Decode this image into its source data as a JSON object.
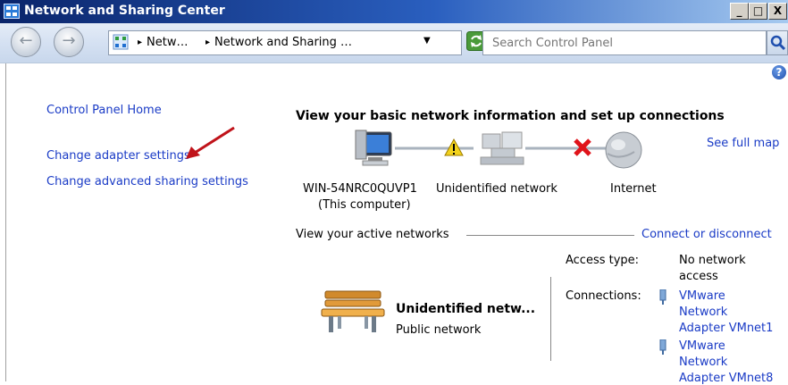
{
  "window": {
    "title": "Network and Sharing Center",
    "minimize": "_",
    "maximize": "□",
    "close": "X"
  },
  "navbar": {
    "back_label": "←",
    "forward_label": "→",
    "breadcrumb_sep": "▸",
    "breadcrumbs": [
      "Netw…",
      "Network and Sharing …"
    ],
    "dropdown_arrow": "▼",
    "search_placeholder": "Search Control Panel"
  },
  "sidebar": {
    "home": "Control Panel Home",
    "links": [
      "Change adapter settings",
      "Change advanced sharing settings"
    ]
  },
  "main": {
    "help": "?",
    "heading": "View your basic network information and set up connections",
    "see_full_map": "See full map",
    "map": {
      "computer_name": "WIN-54NRC0QUVP1",
      "computer_sub": "(This computer)",
      "middle": "Unidentified network",
      "internet": "Internet"
    },
    "active_title": "View your active networks",
    "connect_link": "Connect or disconnect",
    "network": {
      "name": "Unidentified netw...",
      "type": "Public network"
    },
    "access_label": "Access type:",
    "access_value_lines": [
      "No network",
      "access"
    ],
    "connections_label": "Connections:",
    "connections": [
      [
        "VMware",
        "Network",
        "Adapter VMnet1"
      ],
      [
        "VMware",
        "Network",
        "Adapter VMnet8"
      ]
    ]
  },
  "colors": {
    "link": "#1a3bc6",
    "titlebar_start": "#0a246a",
    "titlebar_end": "#a6caf0",
    "arrow": "#c0131a"
  }
}
